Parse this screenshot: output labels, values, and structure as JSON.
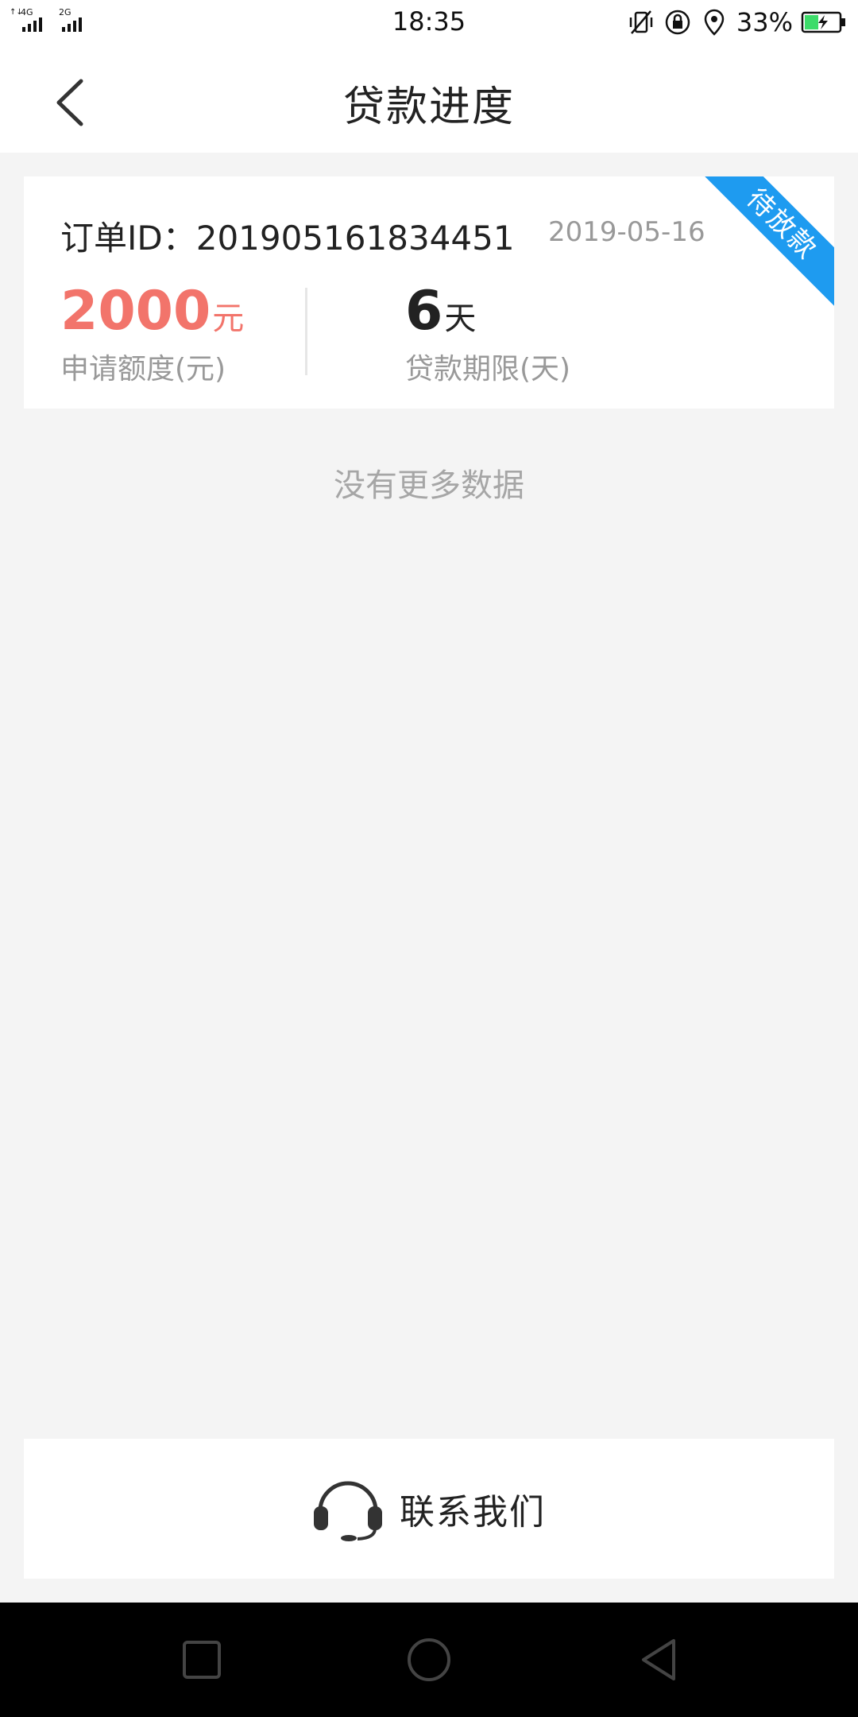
{
  "status_bar": {
    "network_left": "4G",
    "network_right": "2G",
    "time": "18:35",
    "battery": "33%"
  },
  "header": {
    "title": "贷款进度"
  },
  "order_card": {
    "order_id_label": "订单ID：201905161834451",
    "date": "2019-05-16",
    "status": "待放款",
    "amount_value": "2000",
    "amount_unit": "元",
    "amount_label": "申请额度(元)",
    "term_value": "6",
    "term_unit": "天",
    "term_label": "贷款期限(天)",
    "status_color": "#1e9bf0",
    "amount_color": "#f2746b"
  },
  "list": {
    "no_more_text": "没有更多数据"
  },
  "contact": {
    "label": "联系我们",
    "icon": "headset-icon"
  },
  "nav": {
    "recent_icon": "square-icon",
    "home_icon": "circle-icon",
    "back_icon": "triangle-back-icon"
  }
}
